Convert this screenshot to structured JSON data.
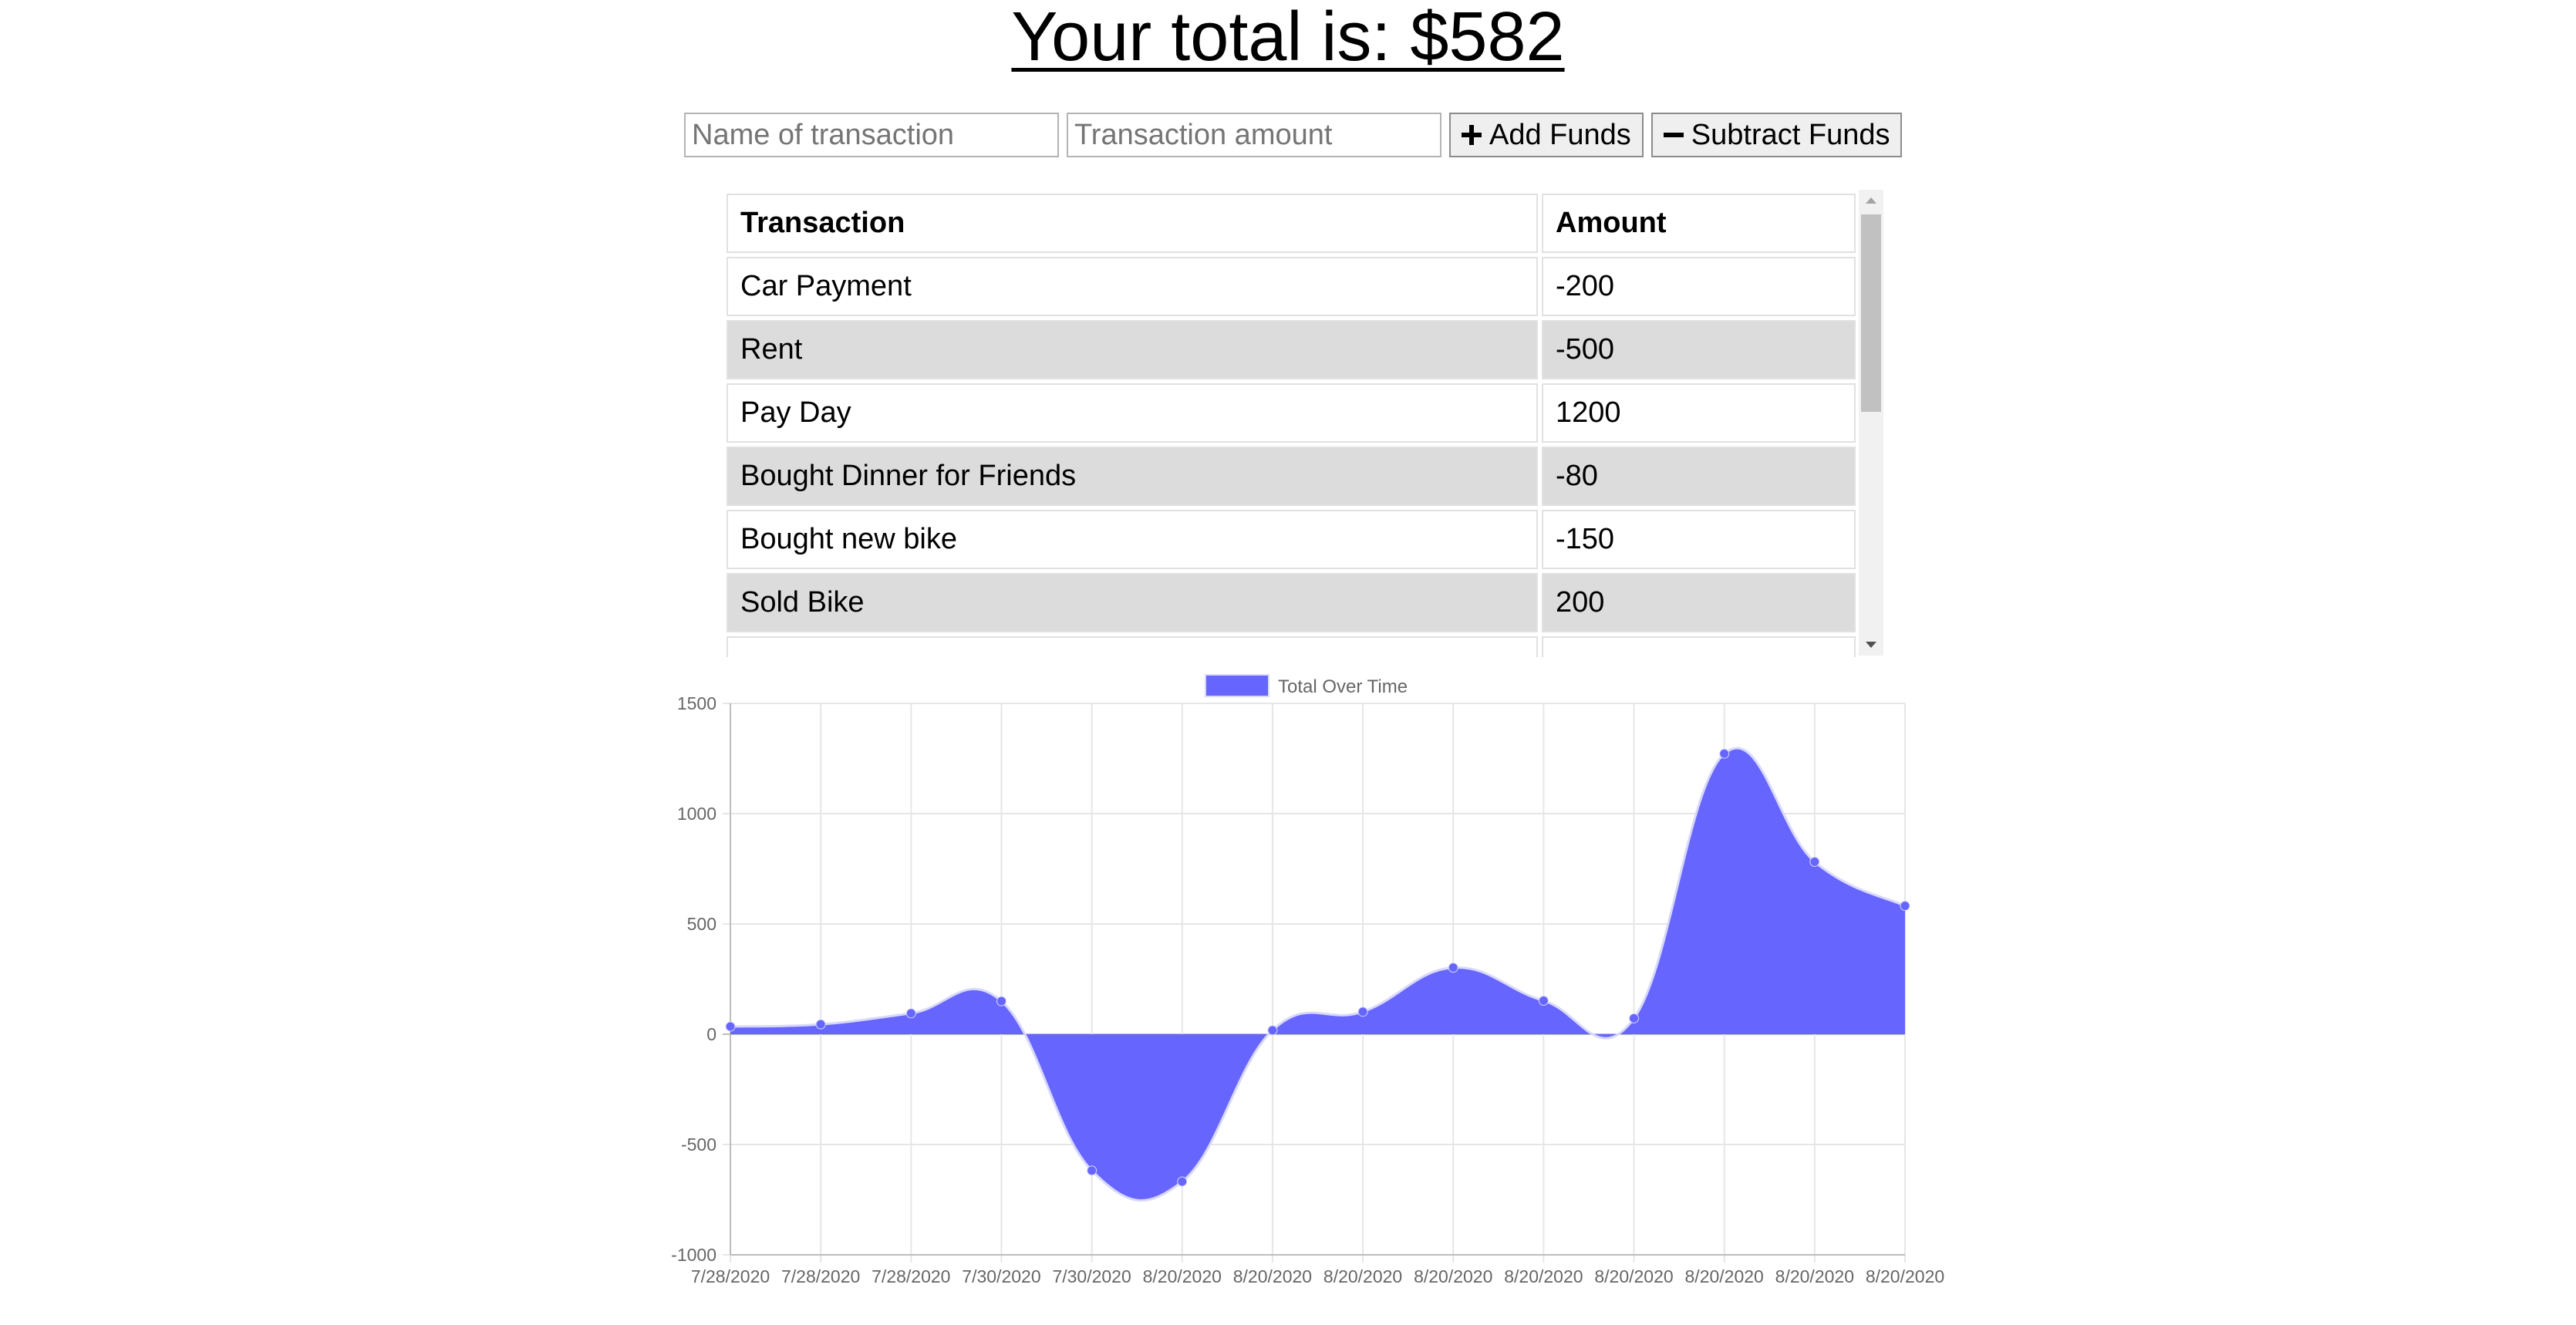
{
  "header": {
    "title": "Your total is: $582"
  },
  "form": {
    "name_placeholder": "Name of transaction",
    "amount_placeholder": "Transaction amount",
    "add_label": "Add Funds",
    "subtract_label": "Subtract Funds"
  },
  "table": {
    "headers": [
      "Transaction",
      "Amount"
    ],
    "rows": [
      {
        "name": "Car Payment",
        "amount": "-200"
      },
      {
        "name": "Rent",
        "amount": "-500"
      },
      {
        "name": "Pay Day",
        "amount": "1200"
      },
      {
        "name": "Bought Dinner for Friends",
        "amount": "-80"
      },
      {
        "name": "Bought new bike",
        "amount": "-150"
      },
      {
        "name": "Sold Bike",
        "amount": "200"
      }
    ]
  },
  "chart_data": {
    "type": "area",
    "x": [
      "7/28/2020",
      "7/28/2020",
      "7/28/2020",
      "7/30/2020",
      "7/30/2020",
      "8/20/2020",
      "8/20/2020",
      "8/20/2020",
      "8/20/2020",
      "8/20/2020",
      "8/20/2020",
      "8/20/2020",
      "8/20/2020",
      "8/20/2020"
    ],
    "series": [
      {
        "name": "Total Over Time",
        "values": [
          35,
          45,
          95,
          150,
          -618,
          -668,
          18,
          102,
          302,
          152,
          72,
          1272,
          782,
          582
        ],
        "color": "#6666ff"
      }
    ],
    "yticks": [
      1500,
      1000,
      500,
      0,
      -500,
      -1000
    ],
    "ylim": [
      -1000,
      1500
    ],
    "grid": true,
    "legend": "top"
  }
}
